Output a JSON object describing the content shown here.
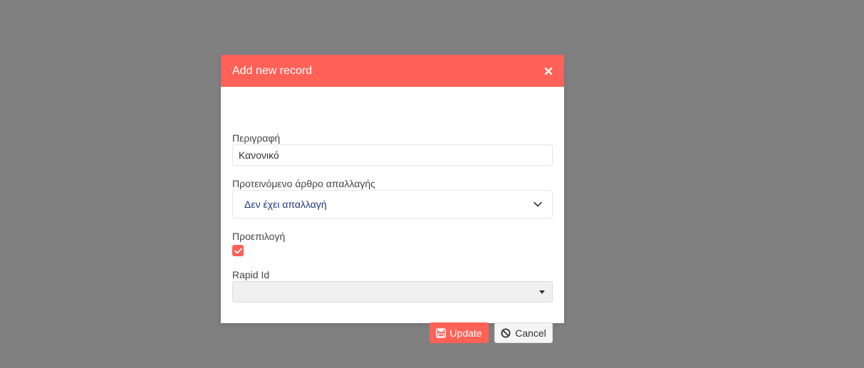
{
  "dialog": {
    "title": "Add new record",
    "close_icon": "close-icon",
    "accent_color": "#ff6157"
  },
  "form": {
    "description": {
      "label": "Περιγραφή",
      "value": "Κανονικό"
    },
    "exemption_article": {
      "label": "Προτεινόμενο άρθρο απαλλαγής",
      "value": "Δεν έχει απαλλαγή",
      "icon": "chevron-down-icon"
    },
    "default": {
      "label": "Προεπιλογή",
      "checked": true
    },
    "rapid_id": {
      "label": "Rapid Id",
      "value": "",
      "icon": "caret-down-icon"
    }
  },
  "actions": {
    "update_label": "Update",
    "update_icon": "save-icon",
    "cancel_label": "Cancel",
    "cancel_icon": "cancel-icon"
  }
}
